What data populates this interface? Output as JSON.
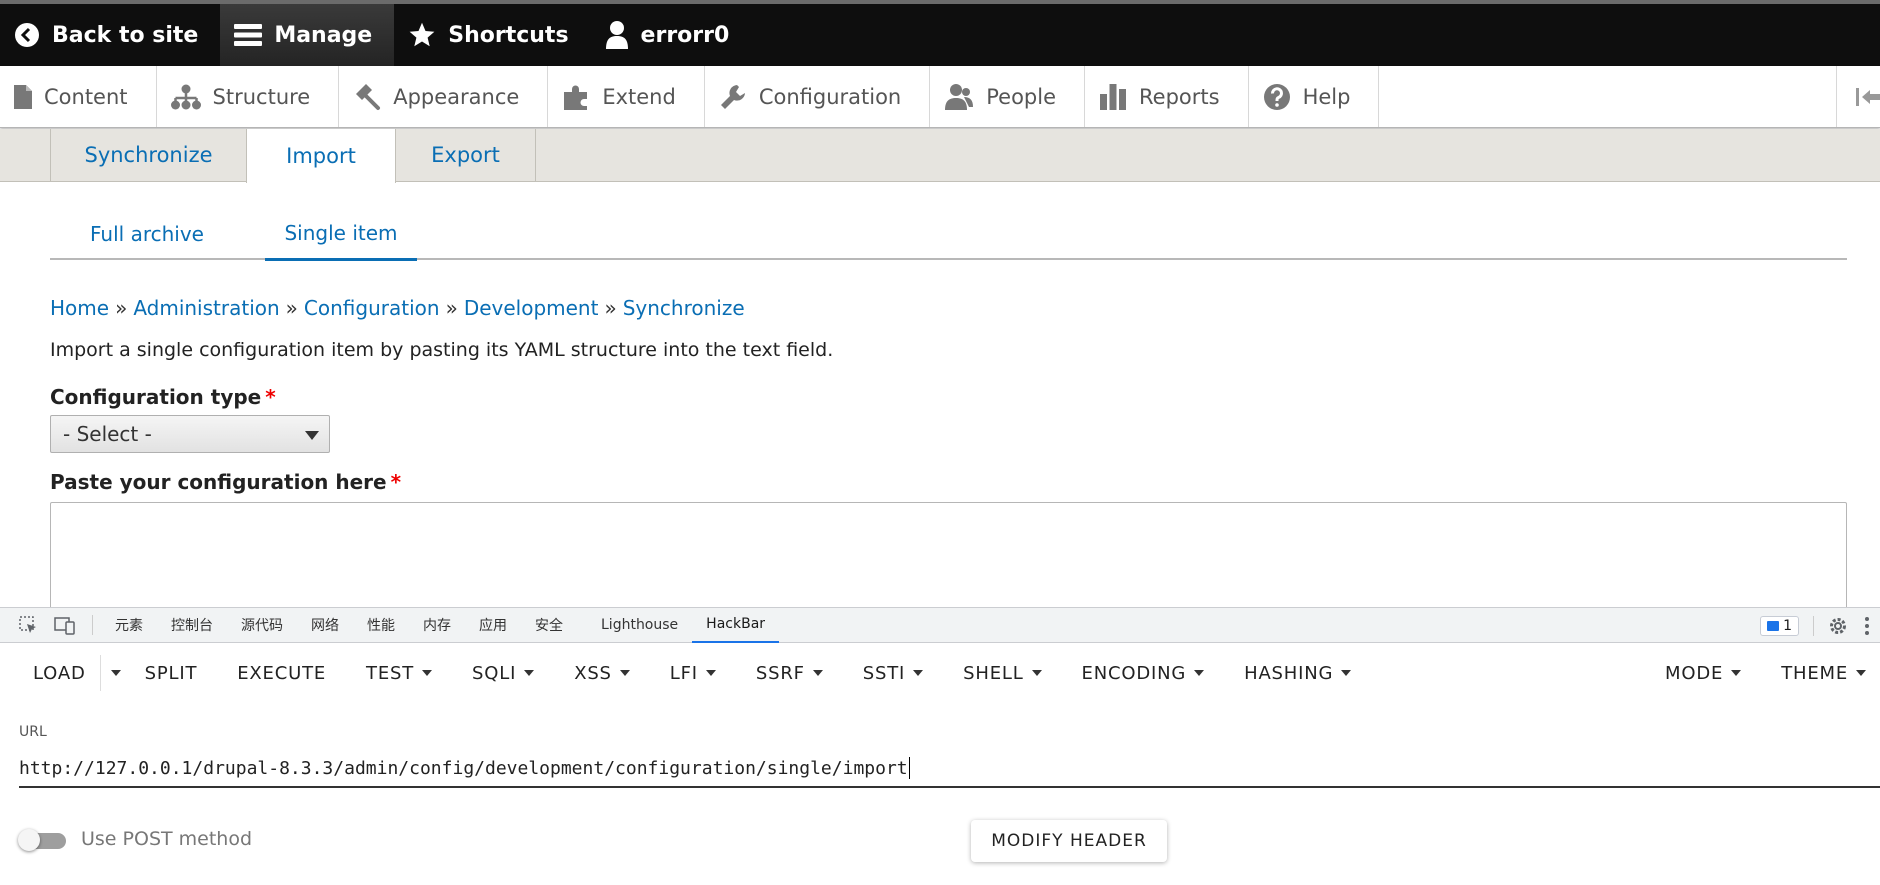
{
  "toolbar": {
    "back_label": "Back to site",
    "manage_label": "Manage",
    "shortcuts_label": "Shortcuts",
    "user_label": "errorr0"
  },
  "tray": {
    "items": [
      "Content",
      "Structure",
      "Appearance",
      "Extend",
      "Configuration",
      "People",
      "Reports",
      "Help"
    ]
  },
  "primary_tabs": [
    "Synchronize",
    "Import",
    "Export"
  ],
  "secondary_tabs": [
    "Full archive",
    "Single item"
  ],
  "breadcrumb": [
    "Home",
    "Administration",
    "Configuration",
    "Development",
    "Synchronize"
  ],
  "breadcrumb_separator": "»",
  "description": "Import a single configuration item by pasting its YAML structure into the text field.",
  "form": {
    "config_type_label": "Configuration type",
    "required_mark": "*",
    "select_value": "- Select -",
    "paste_label": "Paste your configuration here"
  },
  "devtools": {
    "tabs": [
      "元素",
      "控制台",
      "源代码",
      "网络",
      "性能",
      "内存",
      "应用",
      "安全",
      "Lighthouse",
      "HackBar"
    ],
    "active_tab": "HackBar",
    "issues_count": "1"
  },
  "hackbar": {
    "menu": {
      "load": "LOAD",
      "split": "SPLIT",
      "execute": "EXECUTE",
      "test": "TEST",
      "sqli": "SQLI",
      "xss": "XSS",
      "lfi": "LFI",
      "ssrf": "SSRF",
      "ssti": "SSTI",
      "shell": "SHELL",
      "encoding": "ENCODING",
      "hashing": "HASHING",
      "mode": "MODE",
      "theme": "THEME"
    },
    "url_label": "URL",
    "url_value": "http://127.0.0.1/drupal-8.3.3/admin/config/development/configuration/single/import",
    "post_label": "Use POST method",
    "post_enabled": false,
    "modify_header_label": "MODIFY HEADER"
  },
  "colors": {
    "link": "#0a6eb4",
    "toolbar_bg": "#0e0e0e",
    "required": "#ee0000",
    "devtools_accent": "#1a73e8"
  }
}
